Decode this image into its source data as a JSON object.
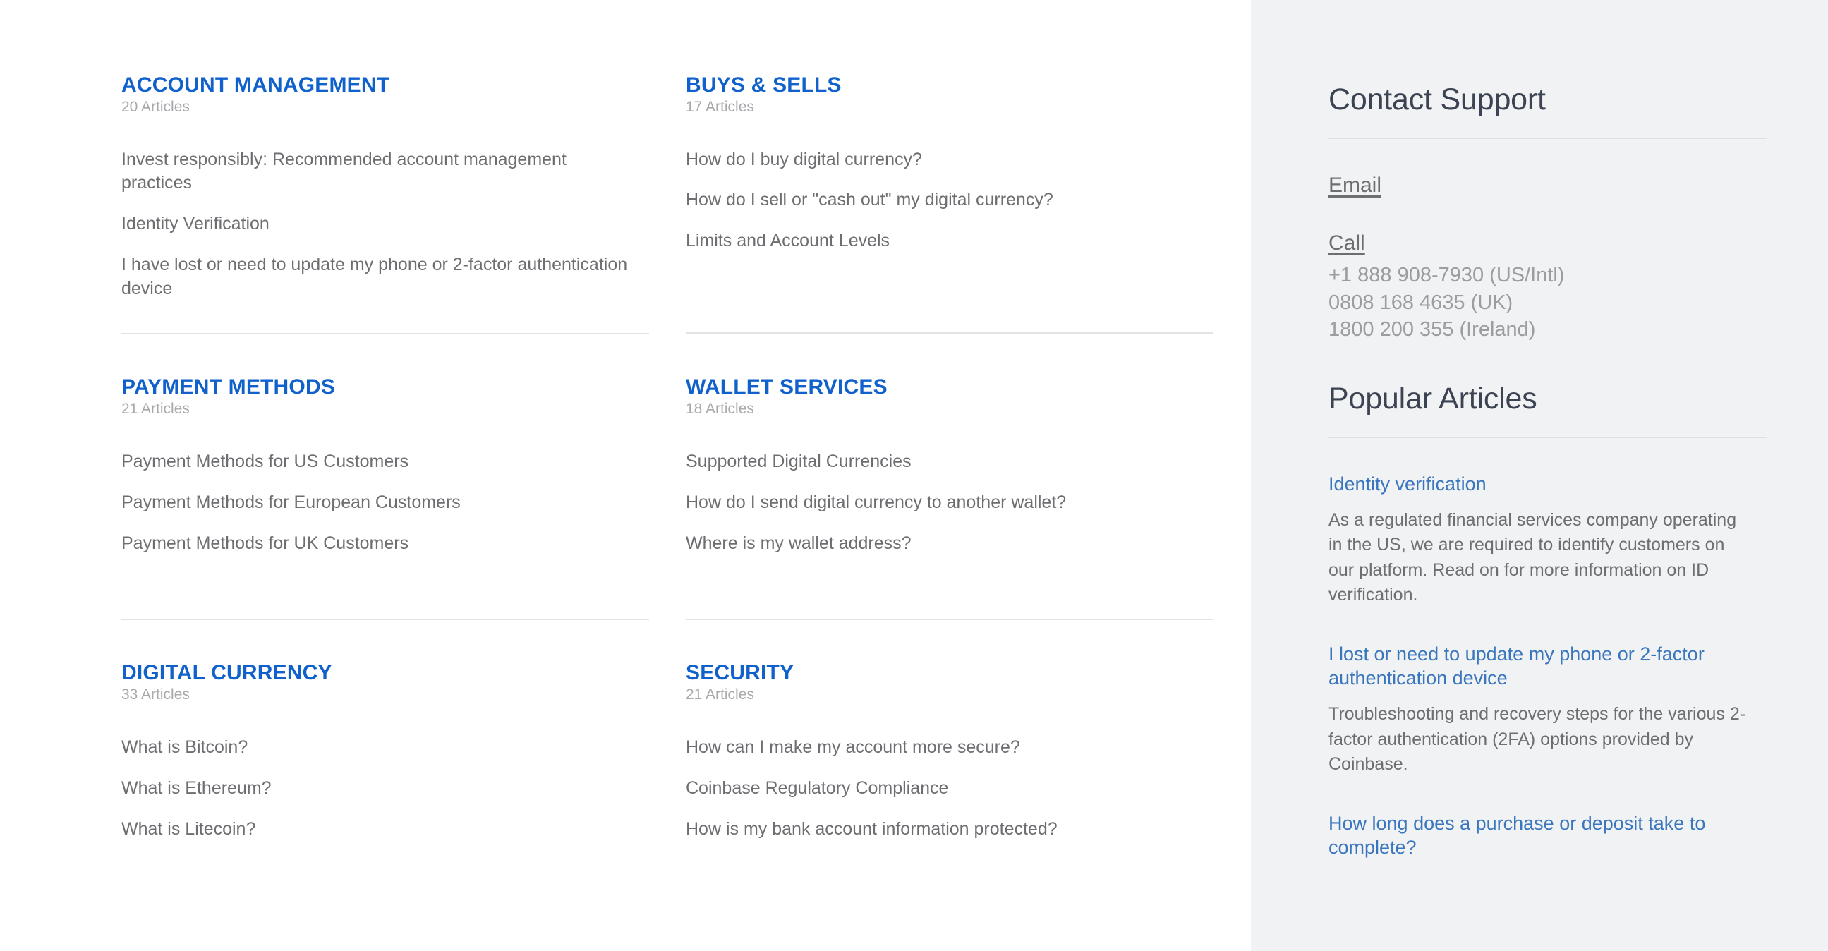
{
  "colors": {
    "category_heading": "#1061cc",
    "body_text": "#6d6e71",
    "muted_text": "#a6a8ab",
    "sidebar_bg": "#f1f2f3",
    "sidebar_link": "#3a76bd",
    "sidebar_heading": "#3c4352",
    "divider": "#e2e3e5"
  },
  "categories": [
    {
      "title": "ACCOUNT MANAGEMENT",
      "count": "20 Articles",
      "links": [
        "Invest responsibly: Recommended account management practices",
        "Identity Verification",
        "I have lost or need to update my phone or 2-factor authentication device"
      ]
    },
    {
      "title": "BUYS & SELLS",
      "count": "17 Articles",
      "links": [
        "How do I buy digital currency?",
        "How do I sell or \"cash out\" my digital currency?",
        "Limits and Account Levels"
      ]
    },
    {
      "title": "PAYMENT METHODS",
      "count": "21 Articles",
      "links": [
        "Payment Methods for US Customers",
        "Payment Methods for European Customers",
        "Payment Methods for UK Customers"
      ]
    },
    {
      "title": "WALLET SERVICES",
      "count": "18 Articles",
      "links": [
        "Supported Digital Currencies",
        "How do I send digital currency to another wallet?",
        "Where is my wallet address?"
      ]
    },
    {
      "title": "DIGITAL CURRENCY",
      "count": "33 Articles",
      "links": [
        "What is Bitcoin?",
        "What is Ethereum?",
        "What is Litecoin?"
      ]
    },
    {
      "title": "SECURITY",
      "count": "21 Articles",
      "links": [
        "How can I make my account more secure?",
        "Coinbase Regulatory Compliance",
        "How is my bank account information protected?"
      ]
    }
  ],
  "sidebar": {
    "contact": {
      "heading": "Contact Support",
      "email_label": "Email",
      "call_label": "Call",
      "phones": [
        "+1 888 908-7930 (US/Intl)",
        "0808 168 4635 (UK)",
        "1800 200 355 (Ireland)"
      ]
    },
    "popular": {
      "heading": "Popular Articles",
      "articles": [
        {
          "title": "Identity verification",
          "description": "As a regulated financial services company operating in the US, we are required to identify customers on our platform. Read on for more information on ID verification."
        },
        {
          "title": "I lost or need to update my phone or 2-factor authentication device",
          "description": "Troubleshooting and recovery steps for the various 2-factor authentication (2FA) options provided by Coinbase."
        },
        {
          "title": "How long does a purchase or deposit take to complete?",
          "description": ""
        }
      ]
    }
  }
}
